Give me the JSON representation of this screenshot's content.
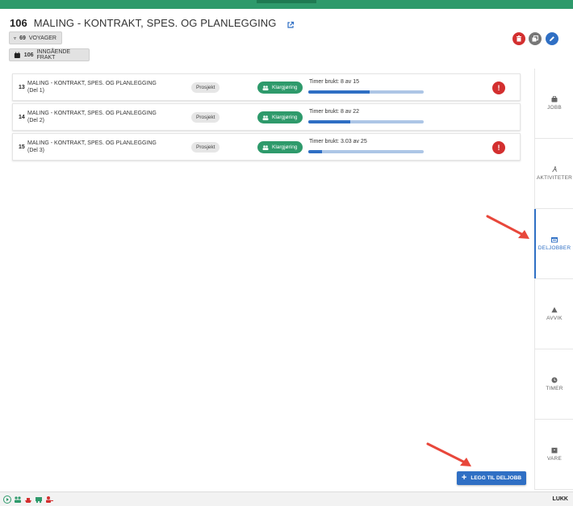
{
  "header": {
    "job_number": "106",
    "job_title": "MALING - KONTRAKT, SPES. OG PLANLEGGING",
    "external_link_icon": "external-link-icon"
  },
  "chips": {
    "voyager": {
      "count": "69",
      "label": "VOYAGER",
      "icon": "route-icon"
    },
    "frakt": {
      "count": "106",
      "label": "INNGÅENDE FRAKT",
      "icon": "calendar-icon"
    }
  },
  "actions": {
    "delete_icon": "trash-icon",
    "copy_icon": "copy-icon",
    "edit_icon": "pencil-icon"
  },
  "subjobs": [
    {
      "num": "13",
      "name": "MALING - KONTRAKT, SPES. OG PLANLEGGING (Del 1)",
      "type": "Prosjekt",
      "status": "Klargjøring",
      "hours_text": "Timer brukt: 8 av 15",
      "used": 8,
      "total": 15,
      "alert": true
    },
    {
      "num": "14",
      "name": "MALING - KONTRAKT, SPES. OG PLANLEGGING (Del 2)",
      "type": "Prosjekt",
      "status": "Klargjøring",
      "hours_text": "Timer brukt: 8 av 22",
      "used": 8,
      "total": 22,
      "alert": false
    },
    {
      "num": "15",
      "name": "MALING - KONTRAKT, SPES. OG PLANLEGGING (Del 3)",
      "type": "Prosjekt",
      "status": "Klargjøring",
      "hours_text": "Timer brukt: 3.03 av 25",
      "used": 3.03,
      "total": 25,
      "alert": true
    }
  ],
  "sidebar": {
    "tabs": [
      {
        "label": "JOBB",
        "icon": "briefcase-icon",
        "active": false
      },
      {
        "label": "AKTIVITETER",
        "icon": "activity-icon",
        "active": false
      },
      {
        "label": "DELJOBBER",
        "icon": "subjobs-icon",
        "active": true
      },
      {
        "label": "AVVIK",
        "icon": "warning-icon",
        "active": false
      },
      {
        "label": "TIMER",
        "icon": "clock-icon",
        "active": false
      },
      {
        "label": "VARE",
        "icon": "box-icon",
        "active": false
      }
    ]
  },
  "add_button": {
    "label": "LEGG TIL DELJOBB",
    "icon": "plus-icon"
  },
  "bottombar": {
    "close_label": "LUKK"
  },
  "colors": {
    "green": "#2e9a6b",
    "blue": "#2f6fc4",
    "red": "#d32f2f",
    "annotation_arrow": "#e8473b"
  }
}
